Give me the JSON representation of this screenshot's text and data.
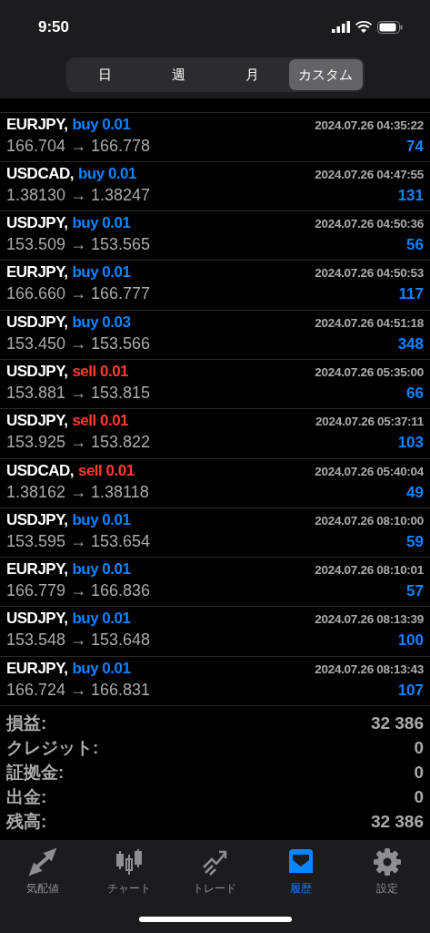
{
  "status_bar": {
    "time": "9:50"
  },
  "segments": [
    {
      "label": "日",
      "selected": false
    },
    {
      "label": "週",
      "selected": false
    },
    {
      "label": "月",
      "selected": false
    },
    {
      "label": "カスタム",
      "selected": true
    }
  ],
  "deals": [
    {
      "symbol": "EURJPY,",
      "side": {
        "kind": "buy",
        "text": "buy 0.01"
      },
      "time": "2024.07.26 04:35:22",
      "prices": "166.704 → 166.778",
      "profit": "74"
    },
    {
      "symbol": "USDCAD,",
      "side": {
        "kind": "buy",
        "text": "buy 0.01"
      },
      "time": "2024.07.26 04:47:55",
      "prices": "1.38130 → 1.38247",
      "profit": "131"
    },
    {
      "symbol": "USDJPY,",
      "side": {
        "kind": "buy",
        "text": "buy 0.01"
      },
      "time": "2024.07.26 04:50:36",
      "prices": "153.509 → 153.565",
      "profit": "56"
    },
    {
      "symbol": "EURJPY,",
      "side": {
        "kind": "buy",
        "text": "buy 0.01"
      },
      "time": "2024.07.26 04:50:53",
      "prices": "166.660 → 166.777",
      "profit": "117"
    },
    {
      "symbol": "USDJPY,",
      "side": {
        "kind": "buy",
        "text": "buy 0.03"
      },
      "time": "2024.07.26 04:51:18",
      "prices": "153.450 → 153.566",
      "profit": "348"
    },
    {
      "symbol": "USDJPY,",
      "side": {
        "kind": "sell",
        "text": "sell 0.01"
      },
      "time": "2024.07.26 05:35:00",
      "prices": "153.881 → 153.815",
      "profit": "66"
    },
    {
      "symbol": "USDJPY,",
      "side": {
        "kind": "sell",
        "text": "sell 0.01"
      },
      "time": "2024.07.26 05:37:11",
      "prices": "153.925 → 153.822",
      "profit": "103"
    },
    {
      "symbol": "USDCAD,",
      "side": {
        "kind": "sell",
        "text": "sell 0.01"
      },
      "time": "2024.07.26 05:40:04",
      "prices": "1.38162 → 1.38118",
      "profit": "49"
    },
    {
      "symbol": "USDJPY,",
      "side": {
        "kind": "buy",
        "text": "buy 0.01"
      },
      "time": "2024.07.26 08:10:00",
      "prices": "153.595 → 153.654",
      "profit": "59"
    },
    {
      "symbol": "EURJPY,",
      "side": {
        "kind": "buy",
        "text": "buy 0.01"
      },
      "time": "2024.07.26 08:10:01",
      "prices": "166.779 → 166.836",
      "profit": "57"
    },
    {
      "symbol": "USDJPY,",
      "side": {
        "kind": "buy",
        "text": "buy 0.01"
      },
      "time": "2024.07.26 08:13:39",
      "prices": "153.548 → 153.648",
      "profit": "100"
    },
    {
      "symbol": "EURJPY,",
      "side": {
        "kind": "buy",
        "text": "buy 0.01"
      },
      "time": "2024.07.26 08:13:43",
      "prices": "166.724 → 166.831",
      "profit": "107"
    }
  ],
  "summary": [
    {
      "label": "損益:",
      "value": "32 386"
    },
    {
      "label": "クレジット:",
      "value": "0"
    },
    {
      "label": "証拠金:",
      "value": "0"
    },
    {
      "label": "出金:",
      "value": "0"
    },
    {
      "label": "残高:",
      "value": "32 386"
    }
  ],
  "tab_bar": [
    {
      "kind": "quotes",
      "label": "気配値",
      "selected": false
    },
    {
      "kind": "chart",
      "label": "チャート",
      "selected": false
    },
    {
      "kind": "trade",
      "label": "トレード",
      "selected": false
    },
    {
      "kind": "history",
      "label": "履歴",
      "selected": true
    },
    {
      "kind": "settings",
      "label": "設定",
      "selected": false
    }
  ]
}
